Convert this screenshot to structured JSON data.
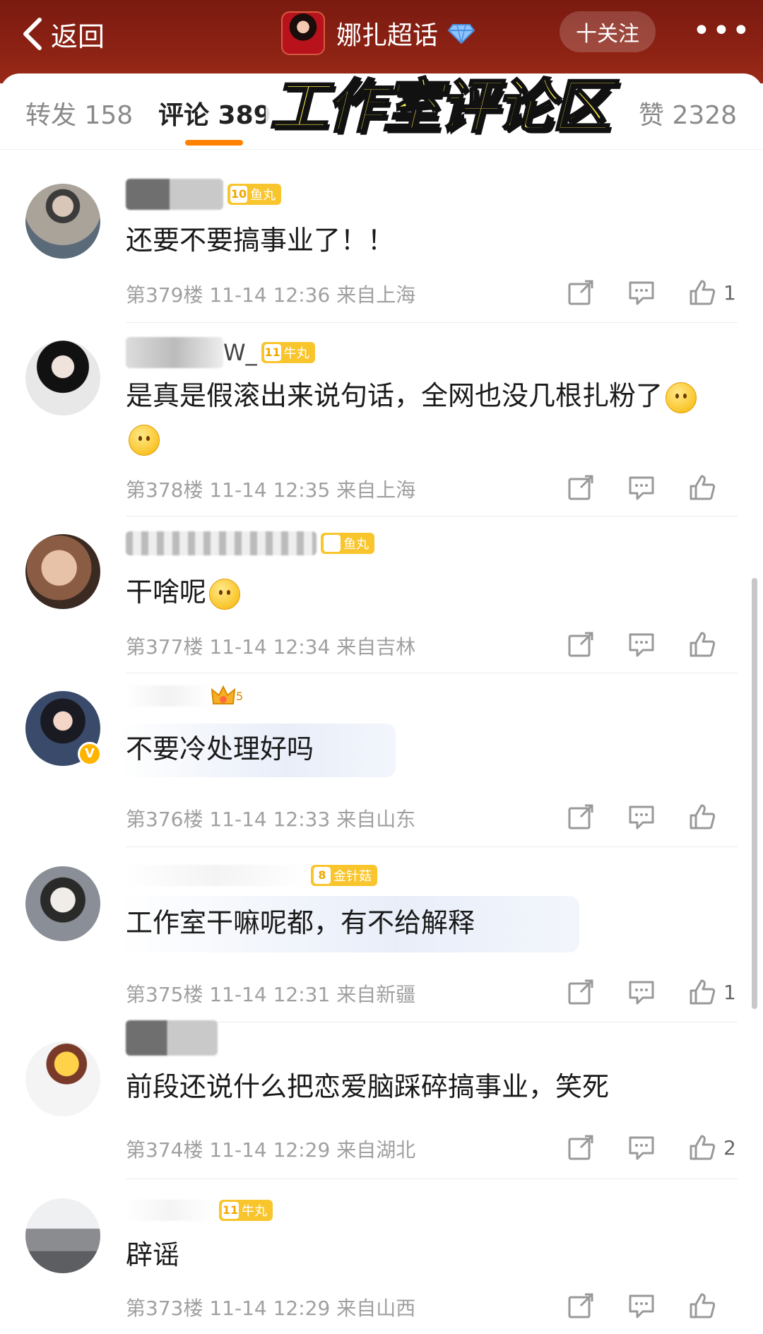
{
  "header": {
    "back_label": "返回",
    "topic_title": "娜扎超话",
    "follow_label": "十关注",
    "more_label": "•••"
  },
  "tabs": [
    {
      "label": "转发 158"
    },
    {
      "label": "评论 389",
      "active": true
    },
    {
      "label": "赞 2328"
    }
  ],
  "overlay_caption": "工作室评论区",
  "comments": [
    {
      "username": "",
      "level": "10",
      "level_label": "鱼丸",
      "text": "还要不要搞事业了！！",
      "meta": "第379楼 11-14 12:36 来自上海",
      "likes": "1"
    },
    {
      "username": "W_",
      "level": "11",
      "level_label": "牛丸",
      "text": "是真是假滚出来说句话，全网也没几根扎粉了",
      "meta": "第378楼 11-14 12:35 来自上海",
      "likes": ""
    },
    {
      "username": "",
      "level": "",
      "level_label": "鱼丸",
      "text": "干啥呢",
      "meta": "第377楼 11-14 12:34 来自吉林",
      "likes": ""
    },
    {
      "username": "",
      "level": "5",
      "level_label": "",
      "text": "不要冷处理好吗",
      "meta": "第376楼 11-14 12:33 来自山东",
      "likes": ""
    },
    {
      "username": "",
      "level": "8",
      "level_label": "金针菇",
      "text": "工作室干嘛呢都，有不给解释",
      "meta": "第375楼 11-14 12:31 来自新疆",
      "likes": "1"
    },
    {
      "username": "",
      "level": "",
      "level_label": "",
      "text": "前段还说什么把恋爱脑踩碎搞事业，笑死",
      "meta": "第374楼 11-14 12:29 来自湖北",
      "likes": "2"
    },
    {
      "username": "",
      "level": "11",
      "level_label": "牛丸",
      "text": "辟谣",
      "meta": "第373楼 11-14 12:29 来自山西",
      "likes": ""
    }
  ],
  "colors": {
    "header_bg": "#8c2214",
    "accent": "#ff8200",
    "level_badge": "#f9c52d"
  },
  "icons": [
    "chevron-left-icon",
    "diamond-badge-icon",
    "share-icon",
    "comment-icon",
    "like-icon",
    "verified-icon",
    "crown-icon"
  ]
}
